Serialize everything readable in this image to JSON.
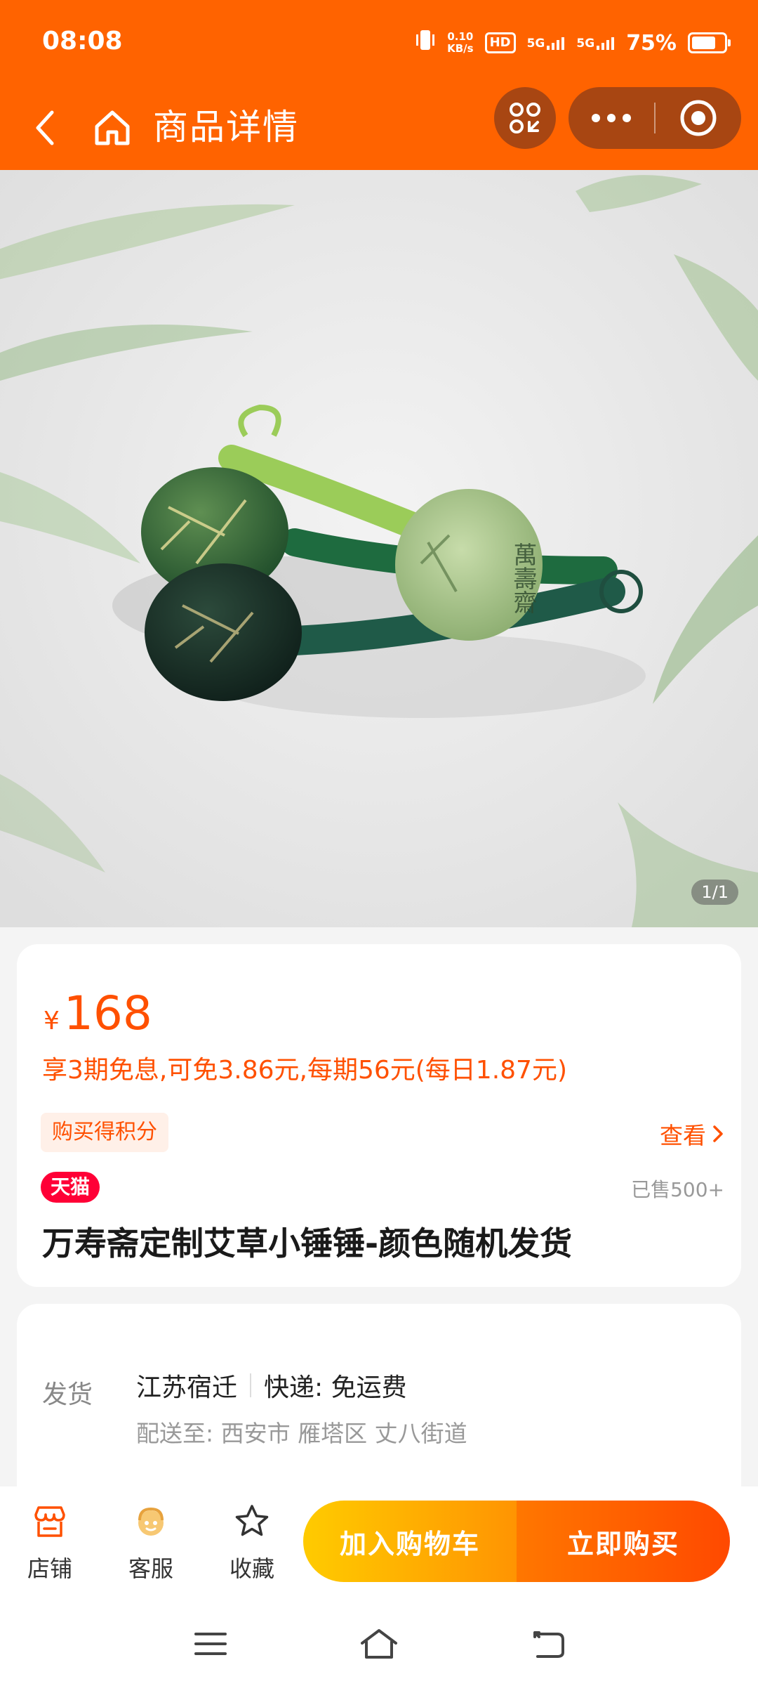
{
  "status_bar": {
    "time": "08:08",
    "net_speed_value": "0.10",
    "net_speed_unit": "KB/s",
    "hd_label": "HD",
    "signal1": "5G",
    "signal2": "5G",
    "battery_text": "75%",
    "battery_level": 0.75,
    "icons": [
      "vibrate-icon",
      "hd-voice-icon",
      "signal-icon",
      "battery-icon"
    ]
  },
  "header": {
    "title": "商品详情",
    "icons": [
      "back-icon",
      "home-icon",
      "scan-icon",
      "more-icon",
      "target-icon"
    ]
  },
  "gallery": {
    "counter": "1/1"
  },
  "product": {
    "currency": "¥",
    "price": "168",
    "installment_text": "享3期免息,可免3.86元,每期56元(每日1.87元)",
    "points_tag": "购买得积分",
    "view_link": "查看",
    "tmall_tag": "天猫",
    "sold": "已售500+",
    "title": "万寿斋定制艾草小锤锤-颜色随机发货"
  },
  "shipping": {
    "label": "发货",
    "origin": "江苏宿迁",
    "express": "快递: 免运费",
    "destination": "配送至: 西安市 雁塔区 丈八街道"
  },
  "action_bar": {
    "shop_label": "店铺",
    "service_label": "客服",
    "favorite_label": "收藏",
    "cart_button": "加入购物车",
    "buy_button": "立即购买"
  },
  "colors": {
    "brand": "#ff6300",
    "price": "#ff5000",
    "tmall": "#ff0036"
  }
}
